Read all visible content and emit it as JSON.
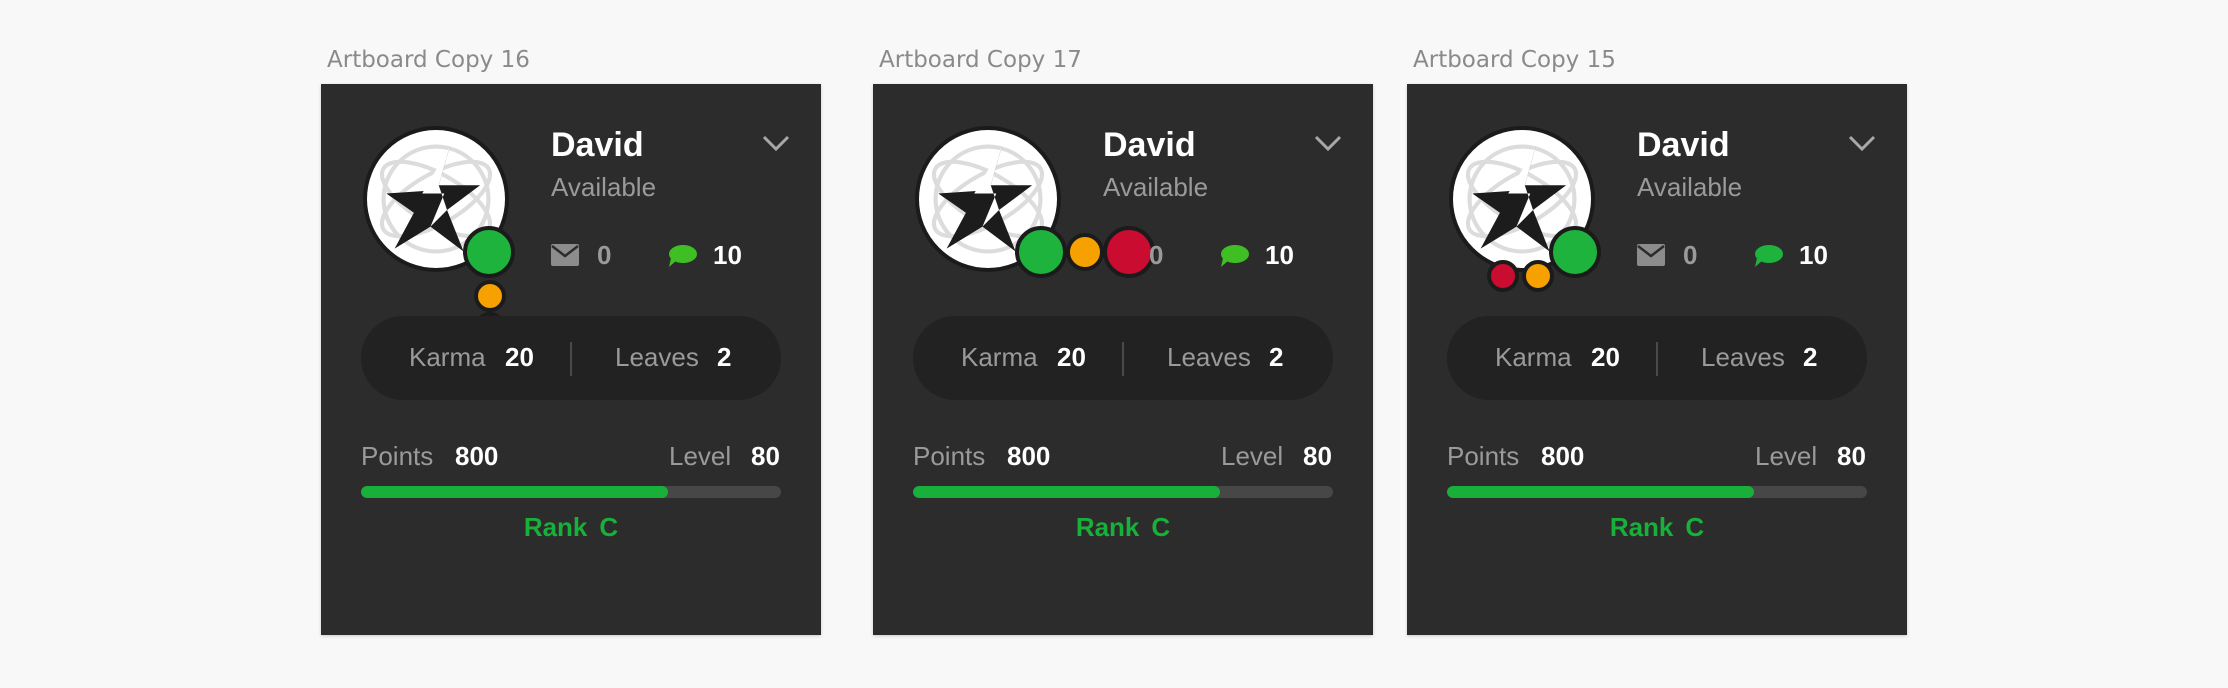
{
  "colors": {
    "background": "#f8f8f8",
    "card": "#2c2c2c",
    "available": "#1db33c",
    "away": "#f6a100",
    "busy": "#c90c30",
    "chat_icon": "#3fbf24",
    "progress": "#18b03a"
  },
  "cards": [
    {
      "artboard_label": "Artboard Copy 16",
      "name": "David",
      "status": "Available",
      "mail_count": "0",
      "chat_count": "10",
      "karma_label": "Karma",
      "karma_value": "20",
      "leaves_label": "Leaves",
      "leaves_value": "2",
      "points_label": "Points",
      "points_value": "800",
      "level_label": "Level",
      "level_value": "80",
      "progress": 0.73,
      "rank_label": "Rank",
      "rank_value": "C",
      "status_dots_arrangement": "vertical"
    },
    {
      "artboard_label": "Artboard Copy 17",
      "name": "David",
      "status": "Available",
      "mail_count": "0",
      "chat_count": "10",
      "karma_label": "Karma",
      "karma_value": "20",
      "leaves_label": "Leaves",
      "leaves_value": "2",
      "points_label": "Points",
      "points_value": "800",
      "level_label": "Level",
      "level_value": "80",
      "progress": 0.73,
      "rank_label": "Rank",
      "rank_value": "C",
      "status_dots_arrangement": "horizontal"
    },
    {
      "artboard_label": "Artboard Copy 15",
      "name": "David",
      "status": "Available",
      "mail_count": "0",
      "chat_count": "10",
      "karma_label": "Karma",
      "karma_value": "20",
      "leaves_label": "Leaves",
      "leaves_value": "2",
      "points_label": "Points",
      "points_value": "800",
      "level_label": "Level",
      "level_value": "80",
      "progress": 0.73,
      "rank_label": "Rank",
      "rank_value": "C",
      "status_dots_arrangement": "arc"
    }
  ],
  "icons": {
    "avatar": "star-logo-icon",
    "dropdown": "chevron-down-icon",
    "mail": "mail-icon",
    "chat": "chat-bubble-icon"
  }
}
